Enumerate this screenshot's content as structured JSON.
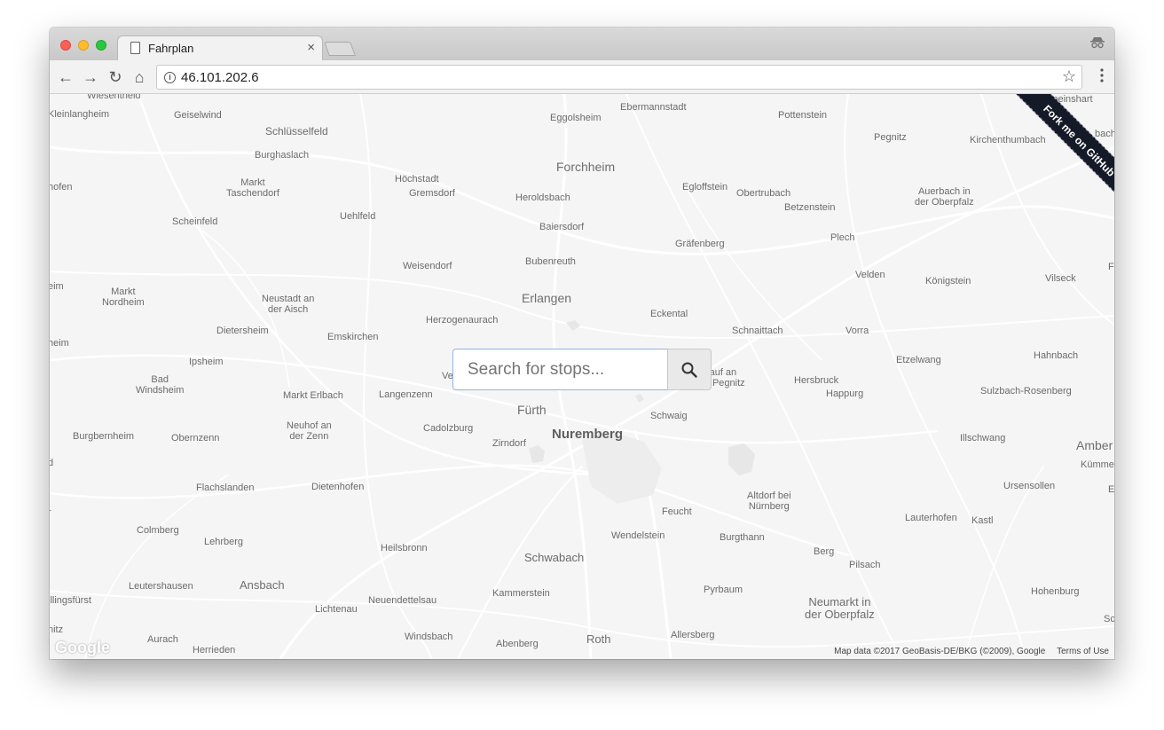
{
  "browser": {
    "tab_title": "Fahrplan",
    "tab_close": "×",
    "url": "46.101.202.6",
    "nav": {
      "back": "←",
      "forward": "→",
      "reload": "↻",
      "home": "⌂"
    },
    "star": "☆",
    "menu": "⋮"
  },
  "map": {
    "search": {
      "placeholder": "Search for stops..."
    },
    "ribbon": "Fork me on GitHub",
    "google_logo": "Google",
    "attribution": "Map data ©2017 GeoBasis-DE/BKG (©2009), Google",
    "terms": "Terms of Use",
    "places": {
      "wiesentheid": "Wiesentheid",
      "kleinlangheim": "Kleinlangheim",
      "geiselwind": "Geiselwind",
      "schluesselfeld": "Schlüsselfeld",
      "eggolsheim": "Eggolsheim",
      "ebermannstadt": "Ebermannstadt",
      "pottenstein": "Pottenstein",
      "speinshart": "Speinshart",
      "pegnitz": "Pegnitz",
      "kirchenthumbach": "Kirchenthumbach",
      "bach": "bach",
      "burghaslach": "Burghaslach",
      "forchheim": "Forchheim",
      "hoechstadt": "Höchstadt",
      "gremsdorf": "Gremsdorf",
      "markt_taschendorf": "Markt\nTaschendorf",
      "hofen": "hofen",
      "egloffstein": "Egloffstein",
      "obertrubach": "Obertrubach",
      "heroldsbach": "Heroldsbach",
      "auerbach": "Auerbach in\nder Oberpfalz",
      "betzenstein": "Betzenstein",
      "scheinfeld": "Scheinfeld",
      "uehlfeld": "Uehlfeld",
      "baiersdorf": "Baiersdorf",
      "plech": "Plech",
      "graefenberg": "Gräfenberg",
      "bubenreuth": "Bubenreuth",
      "weisendorf": "Weisendorf",
      "velden": "Velden",
      "koenigstein": "Königstein",
      "vilseck": "Vilseck",
      "f_edge": "F",
      "eim": "eim",
      "markt_nordheim": "Markt\nNordheim",
      "erlangen": "Erlangen",
      "neustadt": "Neustadt an\nder Aisch",
      "herzogenaurach": "Herzogenaurach",
      "eckental": "Eckental",
      "dietersheim": "Dietersheim",
      "emskirchen": "Emskirchen",
      "schnaittach": "Schnaittach",
      "vorra": "Vorra",
      "heim": "heim",
      "ipsheim": "Ipsheim",
      "etzelwang": "Etzelwang",
      "hahnbach": "Hahnbach",
      "lauf": "Lauf an\nder Pegnitz",
      "bad_windsheim": "Bad\nWindsheim",
      "ve": "Ve",
      "hersbruck": "Hersbruck",
      "happurg": "Happurg",
      "markt_erlbach": "Markt Erlbach",
      "langenzenn": "Langenzenn",
      "sulzbach": "Sulzbach-Rosenberg",
      "fuerth": "Fürth",
      "schwaig": "Schwaig",
      "neuhof": "Neuhof an\nder Zenn",
      "cadolzburg": "Cadolzburg",
      "nuremberg": "Nuremberg",
      "burgbernheim": "Burgbernheim",
      "obernzenn": "Obernzenn",
      "zirndorf": "Zirndorf",
      "illschwang": "Illschwang",
      "amberg": "Amber",
      "kuemmer": "Kümme",
      "d_edge": "d",
      "flachslanden": "Flachslanden",
      "dietenhofen": "Dietenhofen",
      "ursensollen": "Ursensollen",
      "e_edge": "E",
      "altdorf": "Altdorf bei\nNürnberg",
      "feucht": "Feucht",
      "lauterhofen": "Lauterhofen",
      "kastl": "Kastl",
      "r_edge": "r",
      "colmberg": "Colmberg",
      "wendelstein": "Wendelstein",
      "burgthann": "Burgthann",
      "lehrberg": "Lehrberg",
      "heilsbronn": "Heilsbronn",
      "berg": "Berg",
      "pilsach": "Pilsach",
      "schwabach": "Schwabach",
      "leutershausen": "Leutershausen",
      "ansbach": "Ansbach",
      "pyrbaum": "Pyrbaum",
      "hohenburg": "Hohenburg",
      "kammerstein": "Kammerstein",
      "neuendettelsau": "Neuendettelsau",
      "neumarkt": "Neumarkt in\nder Oberpfalz",
      "lingsfuerst": "illingsfürst",
      "lichtenau": "Lichtenau",
      "sc_edge": "Sc",
      "nitz": "nitz",
      "aurach": "Aurach",
      "windsbach": "Windsbach",
      "roth": "Roth",
      "allersberg": "Allersberg",
      "abenberg": "Abenberg",
      "herrieden": "Herrieden"
    }
  }
}
